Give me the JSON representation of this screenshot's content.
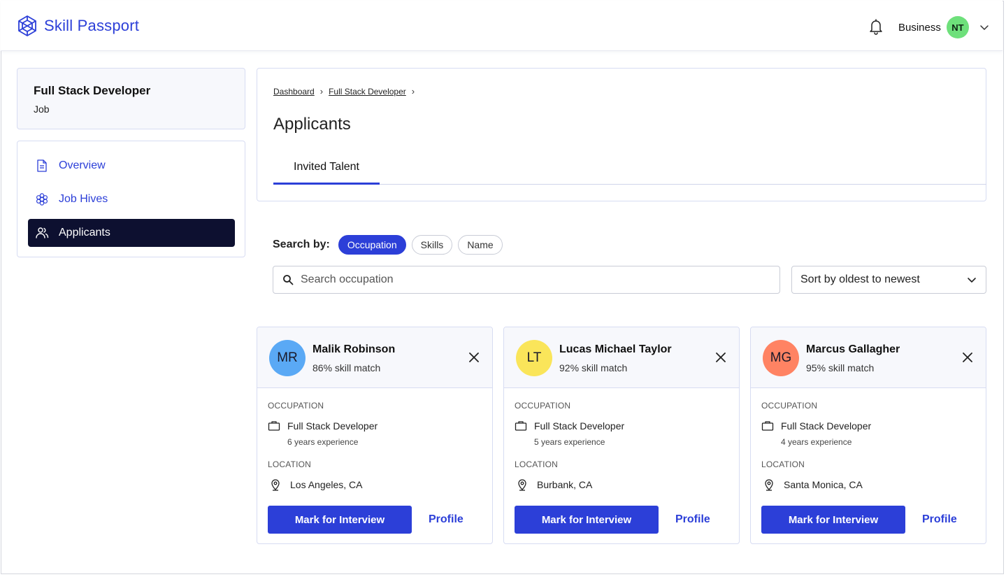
{
  "app": {
    "name": "Skill Passport"
  },
  "account": {
    "label": "Business",
    "initials": "NT",
    "avatar_color": "#6ee07b"
  },
  "job": {
    "title": "Full Stack Developer",
    "type": "Job"
  },
  "nav": {
    "items": [
      {
        "label": "Overview",
        "icon": "document-icon"
      },
      {
        "label": "Job Hives",
        "icon": "hive-icon"
      },
      {
        "label": "Applicants",
        "icon": "users-icon",
        "active": true
      }
    ]
  },
  "breadcrumb": {
    "items": [
      "Dashboard",
      "Full Stack Developer"
    ]
  },
  "page": {
    "title": "Applicants"
  },
  "tabs": [
    {
      "label": "Invited Talent",
      "active": true
    }
  ],
  "search": {
    "label": "Search by:",
    "filters": [
      "Occupation",
      "Skills",
      "Name"
    ],
    "active_filter": "Occupation",
    "placeholder": "Search occupation",
    "value": ""
  },
  "sort": {
    "selected": "Sort by oldest to newest"
  },
  "labels": {
    "occupation": "OCCUPATION",
    "location": "LOCATION",
    "mark_button": "Mark for Interview",
    "profile_link": "Profile"
  },
  "applicants": [
    {
      "initials": "MR",
      "avatar_color": "#5aa9f5",
      "name": "Malik Robinson",
      "match": "86% skill match",
      "occupation": "Full Stack Developer",
      "experience": "6 years experience",
      "location": "Los Angeles, CA"
    },
    {
      "initials": "LT",
      "avatar_color": "#fae55a",
      "name": "Lucas Michael Taylor",
      "match": "92% skill match",
      "occupation": "Full Stack Developer",
      "experience": "5 years experience",
      "location": "Burbank, CA"
    },
    {
      "initials": "MG",
      "avatar_color": "#ff8363",
      "name": "Marcus Gallagher",
      "match": "95% skill match",
      "occupation": "Full Stack Developer",
      "experience": "4 years experience",
      "location": "Santa Monica, CA"
    }
  ],
  "colors": {
    "accent": "#2c3fd8",
    "nav_active_bg": "#0d1030",
    "card_head_bg": "#f7f8fc",
    "border": "#d7dcf2"
  }
}
